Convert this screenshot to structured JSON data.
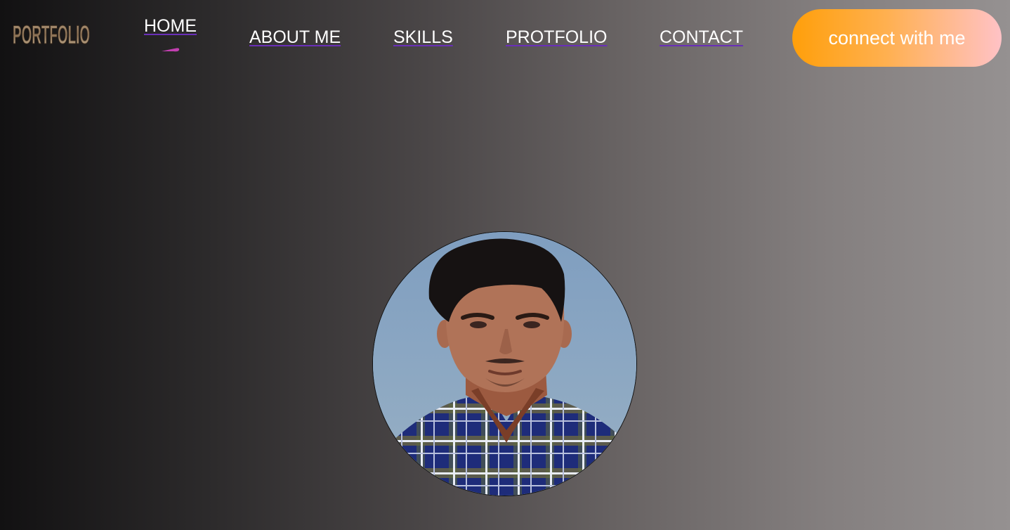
{
  "logo": {
    "text": "PORTFOLIO",
    "icon": "portfolio-logo"
  },
  "nav": {
    "items": [
      {
        "label": "HOME",
        "active": true
      },
      {
        "label": "ABOUT ME"
      },
      {
        "label": "SKILLS"
      },
      {
        "label": "PROTFOLIO"
      },
      {
        "label": "CONTACT"
      }
    ],
    "underline_color": "#6a2fb8",
    "active_indicator_color": "#c23fb0"
  },
  "cta": {
    "label": "connect with me",
    "gradient": [
      "#ff9f0a",
      "#ffc2c6"
    ]
  },
  "hero": {
    "profile_photo": "profile-photo"
  }
}
